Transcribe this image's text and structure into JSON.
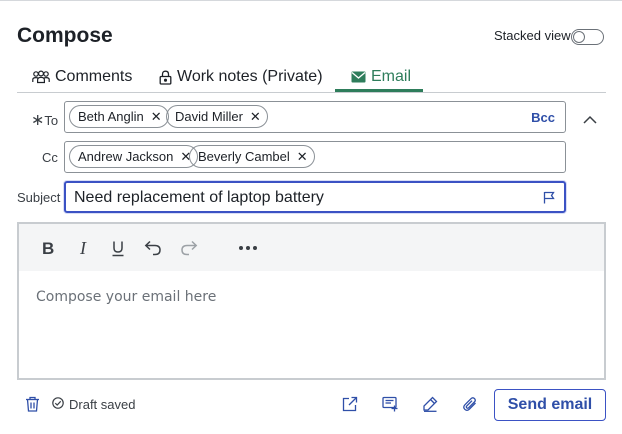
{
  "header": {
    "title": "Compose",
    "stacked_view_label": "Stacked view",
    "stacked_view_on": false
  },
  "tabs": [
    {
      "label": "Comments",
      "icon": "people-icon",
      "active": false
    },
    {
      "label": "Work notes (Private)",
      "icon": "lock-icon",
      "active": false
    },
    {
      "label": "Email",
      "icon": "envelope-icon",
      "active": true
    }
  ],
  "to": {
    "label": "To",
    "required_marker": "∗",
    "recipients": [
      "Beth Anglin",
      "David Miller"
    ],
    "bcc_label": "Bcc"
  },
  "cc": {
    "label": "Cc",
    "recipients": [
      "Andrew Jackson",
      "Beverly Cambel"
    ]
  },
  "subject": {
    "label": "Subject",
    "value": "Need replacement of laptop battery"
  },
  "editor": {
    "placeholder": "Compose your email here",
    "toolbar": [
      "bold-icon",
      "italic-icon",
      "underline-icon",
      "undo-icon",
      "redo-icon",
      "more-icon"
    ]
  },
  "footer": {
    "draft_status": "Draft saved",
    "send_label": "Send email"
  },
  "colors": {
    "accent_green": "#2e7d5b",
    "accent_blue": "#3b52c4"
  }
}
